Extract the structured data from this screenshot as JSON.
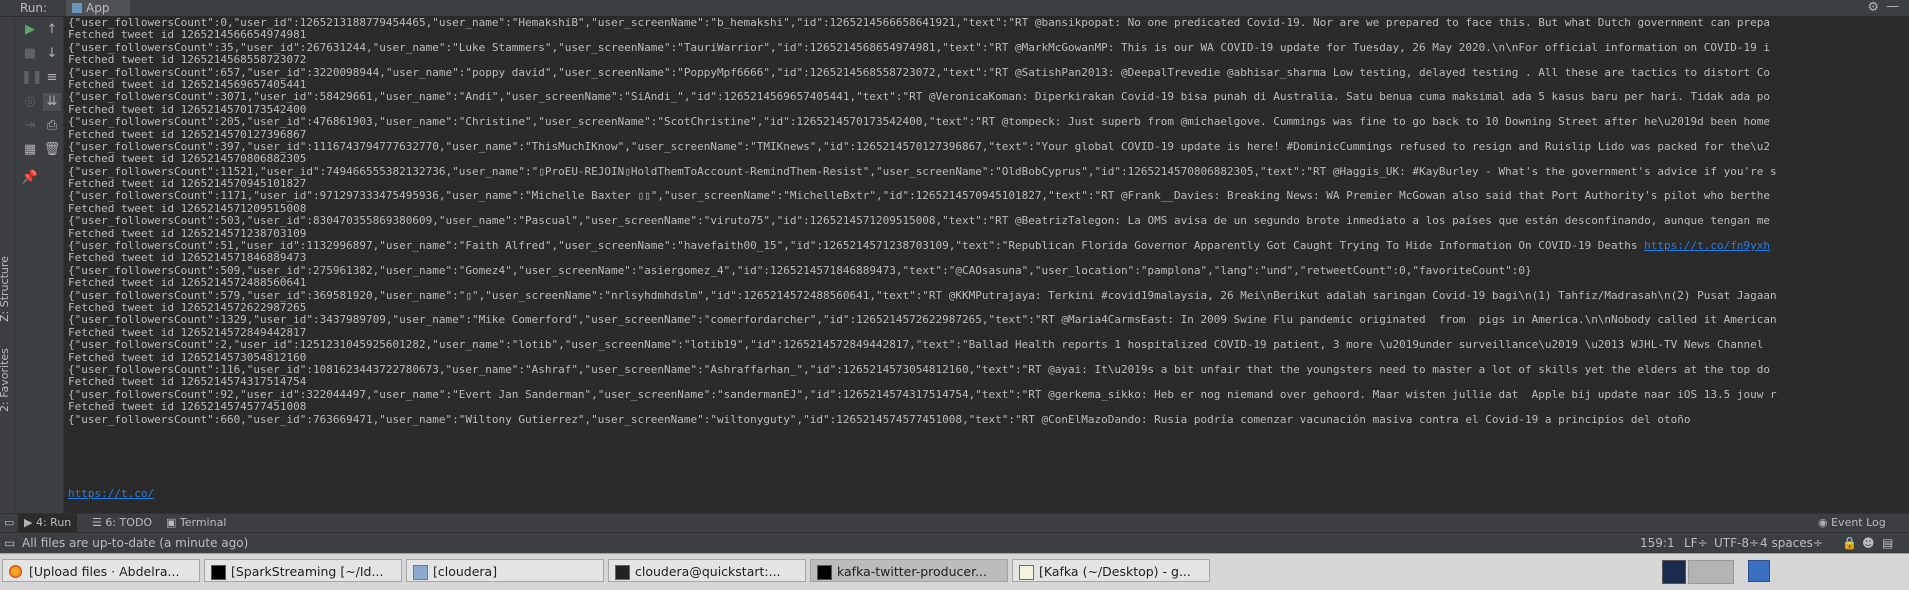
{
  "panel": {
    "run_label": "Run:",
    "tab_label": "App"
  },
  "left_strip": {
    "structure_label": "Z: Structure",
    "favorites_label": "2: Favorites"
  },
  "console_lines": [
    "{\"user_followersCount\":0,\"user_id\":1265213188779454465,\"user_name\":\"HemakshiB\",\"user_screenName\":\"b_hemakshi\",\"id\":1265214566658641921,\"text\":\"RT @bansikpopat: No one predicated Covid-19. Nor are we prepared to face this. But what Dutch government can prepa",
    "Fetched tweet id 1265214566654974981",
    "{\"user_followersCount\":35,\"user_id\":267631244,\"user_name\":\"Luke Stammers\",\"user_screenName\":\"TauriWarrior\",\"id\":1265214568654974981,\"text\":\"RT @MarkMcGowanMP: This is our WA COVID-19 update for Tuesday, 26 May 2020.\\n\\nFor official information on COVID-19 i",
    "Fetched tweet id 1265214568558723072",
    "{\"user_followersCount\":657,\"user_id\":3220098944,\"user_name\":\"poppy david\",\"user_screenName\":\"PoppyMpf6666\",\"id\":1265214568558723072,\"text\":\"RT @SatishPan2013: @DeepalTrevedie @abhisar_sharma Low testing, delayed testing . All these are tactics to distort Co",
    "Fetched tweet id 1265214569657405441",
    "{\"user_followersCount\":3071,\"user_id\":58429661,\"user_name\":\"Andi\",\"user_screenName\":\"SiAndi_\",\"id\":1265214569657405441,\"text\":\"RT @VeronicaKoman: Diperkirakan Covid-19 bisa punah di Australia. Satu benua cuma maksimal ada 5 kasus baru per hari. Tidak ada po",
    "Fetched tweet id 1265214570173542400",
    "{\"user_followersCount\":205,\"user_id\":476861903,\"user_name\":\"Christine\",\"user_screenName\":\"ScotChristine\",\"id\":1265214570173542400,\"text\":\"RT @tompeck: Just superb from @michaelgove. Cummings was fine to go back to 10 Downing Street after he\\u2019d been home",
    "Fetched tweet id 1265214570127396867",
    "{\"user_followersCount\":397,\"user_id\":1116743794777632770,\"user_name\":\"ThisMuchIKnow\",\"user_screenName\":\"TMIKnews\",\"id\":1265214570127396867,\"text\":\"Your global COVID-19 update is here! #DominicCummings refused to resign and Ruislip Lido was packed for the\\u2",
    "Fetched tweet id 1265214570806882305",
    "{\"user_followersCount\":11521,\"user_id\":749466555382132736,\"user_name\":\"▯ProEU-REJOIN▯HoldThemToAccount-RemindThem-Resist\",\"user_screenName\":\"OldBobCyprus\",\"id\":1265214570806882305,\"text\":\"RT @Haggis_UK: #KayBurley - What's the government's advice if you're s",
    "Fetched tweet id 1265214570945101827",
    "{\"user_followersCount\":1171,\"user_id\":971297333475495936,\"user_name\":\"Michelle Baxter ▯▯\",\"user_screenName\":\"MichelleBxtr\",\"id\":1265214570945101827,\"text\":\"RT @Frank__Davies: Breaking News: WA Premier McGowan also said that Port Authority's pilot who berthe",
    "Fetched tweet id 1265214571209515008",
    "{\"user_followersCount\":503,\"user_id\":830470355869380609,\"user_name\":\"Pascual\",\"user_screenName\":\"viruto75\",\"id\":1265214571209515008,\"text\":\"RT @BeatrizTalegon: La OMS avisa de un segundo brote inmediato a los países que están desconfinando, aunque tengan me",
    "Fetched tweet id 1265214571238703109",
    "{\"user_followersCount\":51,\"user_id\":1132996897,\"user_name\":\"Faith Alfred\",\"user_screenName\":\"havefaith00_15\",\"id\":1265214571238703109,\"text\":\"Republican Florida Governor Apparently Got Caught Trying To Hide Information On COVID-19 Deaths ",
    "Fetched tweet id 1265214571846889473",
    "{\"user_followersCount\":509,\"user_id\":275961382,\"user_name\":\"Gomez4\",\"user_screenName\":\"asiergomez_4\",\"id\":1265214571846889473,\"text\":\"@CAOsasuna\",\"user_location\":\"pamplona\",\"lang\":\"und\",\"retweetCount\":0,\"favoriteCount\":0}",
    "Fetched tweet id 1265214572488560641",
    "{\"user_followersCount\":579,\"user_id\":369581920,\"user_name\":\"▯\",\"user_screenName\":\"nrlsyhdmhdslm\",\"id\":1265214572488560641,\"text\":\"RT @KKMPutrajaya: Terkini #covid19malaysia, 26 Mei\\nBerikut adalah saringan Covid-19 bagi\\n(1) Tahfiz/Madrasah\\n(2) Pusat Jagaan",
    "Fetched tweet id 1265214572622987265",
    "{\"user_followersCount\":1329,\"user_id\":3437989709,\"user_name\":\"Mike Comerford\",\"user_screenName\":\"comerfordarcher\",\"id\":1265214572622987265,\"text\":\"RT @Maria4CarmsEast: In 2009 Swine Flu pandemic originated  from  pigs in America.\\n\\nNobody called it American",
    "Fetched tweet id 1265214572849442817",
    "{\"user_followersCount\":2,\"user_id\":1251231045925601282,\"user_name\":\"lotib\",\"user_screenName\":\"lotib19\",\"id\":1265214572849442817,\"text\":\"Ballad Health reports 1 hospitalized COVID-19 patient, 3 more \\u2019under surveillance\\u2019 \\u2013 WJHL-TV News Channel",
    "Fetched tweet id 1265214573054812160",
    "{\"user_followersCount\":116,\"user_id\":1081623443722780673,\"user_name\":\"Ashraf\",\"user_screenName\":\"Ashraffarhan_\",\"id\":1265214573054812160,\"text\":\"RT @ayai: It\\u2019s a bit unfair that the youngsters need to master a lot of skills yet the elders at the top do",
    "Fetched tweet id 1265214574317514754",
    "{\"user_followersCount\":92,\"user_id\":322044497,\"user_name\":\"Evert Jan Sanderman\",\"user_screenName\":\"sandermanEJ\",\"id\":1265214574317514754,\"text\":\"RT @gerkema_sikko: Heb er nog niemand over gehoord. Maar wisten jullie dat  Apple bij update naar iOS 13.5 jouw r",
    "Fetched tweet id 1265214574577451008",
    "{\"user_followersCount\":660,\"user_id\":763669471,\"user_name\":\"Wiltony Gutierrez\",\"user_screenName\":\"wiltonyguty\",\"id\":1265214574577451008,\"text\":\"RT @ConElMazoDando: Rusia podría comenzar vacunación masiva contra el Covid-19 a principios del otoño "
  ],
  "links": {
    "line_17": "https://t.co/fn9yxh",
    "line_31": "https://t.co/"
  },
  "tool_tabs": {
    "run": "4: Run",
    "todo": "6: TODO",
    "terminal": "Terminal",
    "event_log": "Event Log"
  },
  "status": {
    "message": "All files are up-to-date (a minute ago)",
    "position": "159:1",
    "line_sep": "LF÷",
    "encoding": "UTF-8÷",
    "indent": "4 spaces÷"
  },
  "taskbar": [
    {
      "label": "[Upload files · Abdelra...",
      "icon": "firefox-icon"
    },
    {
      "label": "[SparkStreaming [~/Id...",
      "icon": "intellij-icon"
    },
    {
      "label": "[cloudera]",
      "icon": "folder-icon"
    },
    {
      "label": "cloudera@quickstart:...",
      "icon": "terminal-icon"
    },
    {
      "label": "kafka-twitter-producer...",
      "icon": "intellij-icon"
    },
    {
      "label": "[Kafka (~/Desktop) - g...",
      "icon": "gedit-icon"
    }
  ],
  "colors": {
    "console_bg": "#2b2b2b",
    "panel_bg": "#3c3f41",
    "text": "#bbbbbb",
    "link": "#287bde",
    "run_green": "#59a869"
  }
}
